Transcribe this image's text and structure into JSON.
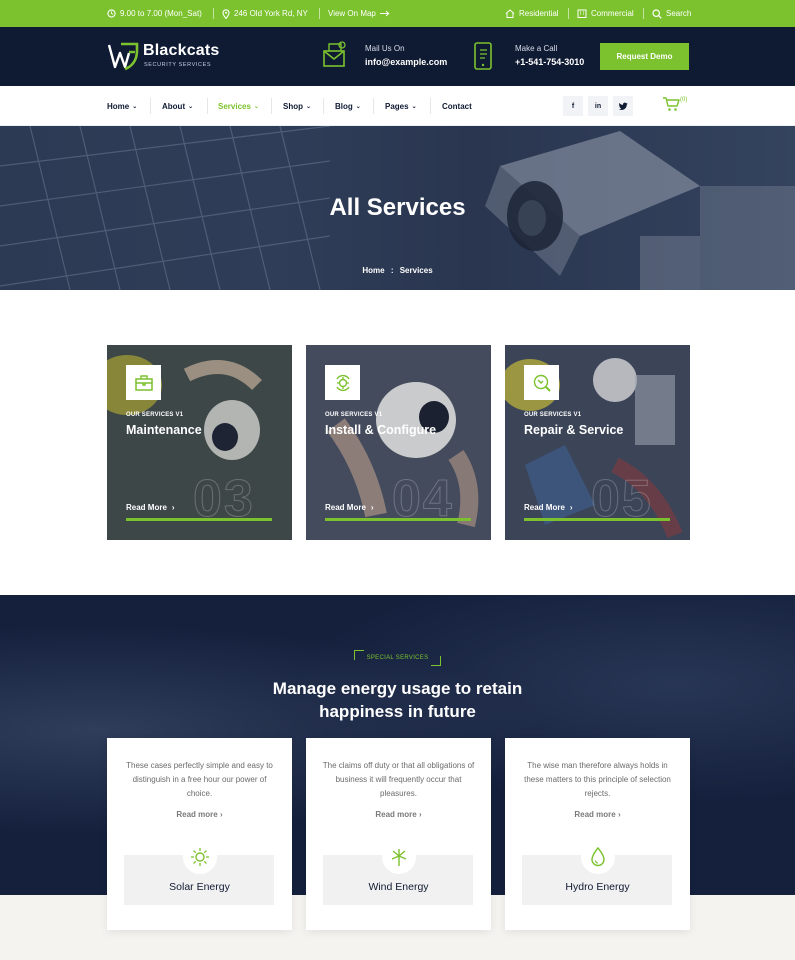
{
  "topbar": {
    "hours": "9.00 to 7.00 (Mon_Sat)",
    "address": "246 Old York Rd, NY",
    "map_link": "View On Map",
    "residential": "Residential",
    "commercial": "Commercial",
    "search": "Search"
  },
  "header": {
    "brand": "Blackcats",
    "brand_sub": "SECURITY SERVICES",
    "mail_label": "Mail Us On",
    "mail_value": "info@example.com",
    "call_label": "Make a Call",
    "call_value": "+1-541-754-3010",
    "demo_button": "Request Demo"
  },
  "nav": {
    "items": [
      {
        "label": "Home",
        "dropdown": true
      },
      {
        "label": "About",
        "dropdown": true
      },
      {
        "label": "Services",
        "dropdown": true,
        "active": true
      },
      {
        "label": "Shop",
        "dropdown": true
      },
      {
        "label": "Blog",
        "dropdown": true
      },
      {
        "label": "Pages",
        "dropdown": true
      },
      {
        "label": "Contact",
        "dropdown": false
      }
    ],
    "social": [
      "facebook-icon",
      "linkedin-icon",
      "twitter-icon"
    ],
    "cart_count": "(0)"
  },
  "hero": {
    "title": "All Services",
    "breadcrumb_home": "Home",
    "breadcrumb_sep": ":",
    "breadcrumb_current": "Services"
  },
  "services": [
    {
      "kicker": "OUR SERVICES V1",
      "title": "Maintenance",
      "number": "03",
      "link": "Read More"
    },
    {
      "kicker": "OUR SERVICES V1",
      "title": "Install & Configure",
      "number": "04",
      "link": "Read More"
    },
    {
      "kicker": "OUR SERVICES V1",
      "title": "Repair & Service",
      "number": "05",
      "link": "Read More"
    }
  ],
  "special": {
    "tag": "SPECIAL SERVICES",
    "heading_line1": "Manage energy usage to retain",
    "heading_line2": "happiness in future",
    "cards": [
      {
        "desc": "These cases perfectly simple and easy to distinguish in a free hour our power of choice.",
        "link": "Read more",
        "name": "Solar Energy",
        "icon": "sun-icon"
      },
      {
        "desc": "The claims off duty or that all obligations of business it will frequently occur that pleasures.",
        "link": "Read more",
        "name": "Wind Energy",
        "icon": "wind-turbine-icon"
      },
      {
        "desc": "The wise man therefore always holds in these matters to this principle of selection rejects.",
        "link": "Read more",
        "name": "Hydro Energy",
        "icon": "water-drop-icon"
      }
    ]
  },
  "colors": {
    "accent": "#7cc22e",
    "navy": "#0f1a33"
  }
}
